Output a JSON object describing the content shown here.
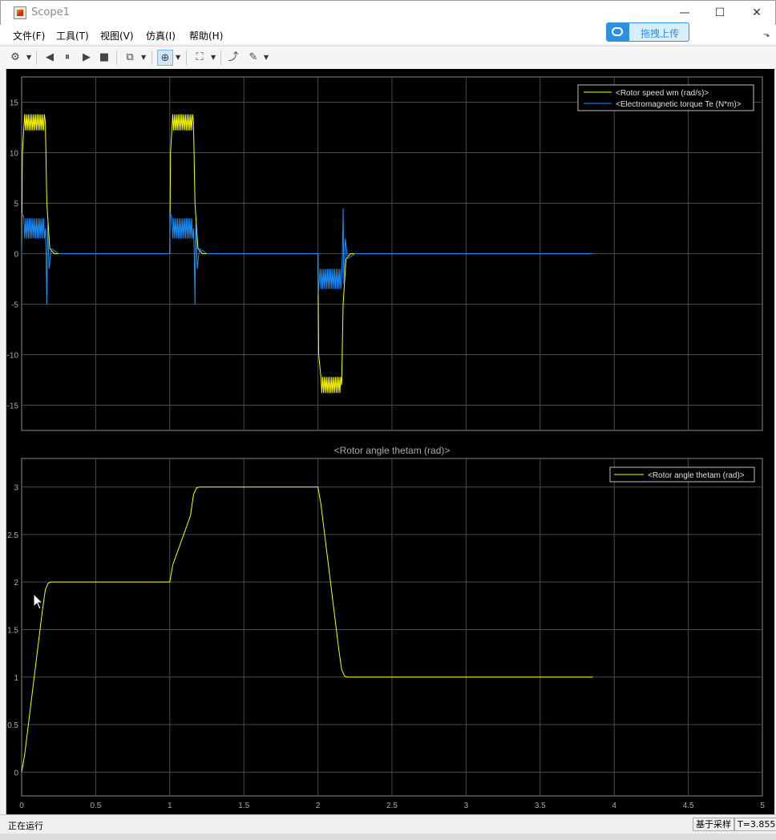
{
  "window": {
    "title": "Scope1",
    "minimize_glyph": "—",
    "maximize_glyph": "☐",
    "close_glyph": "✕"
  },
  "menu": {
    "items": [
      "文件(F)",
      "工具(T)",
      "视图(V)",
      "仿真(I)",
      "帮助(H)"
    ],
    "upload_button": "拖拽上传"
  },
  "toolbar": {
    "icons": [
      "gear-icon",
      "step-back-icon",
      "pause-icon",
      "step-forward-icon",
      "stop-icon",
      "signal-selector-icon",
      "zoom-in-icon",
      "autoscale-icon",
      "restore-icon",
      "style-icon"
    ]
  },
  "colors": {
    "plot_bg": "#000000",
    "axes_text": "#aaaaaa",
    "grid": "#4a4a4a",
    "speed": "#ffff00",
    "torque": "#1e90ff",
    "angle": "#ffff00"
  },
  "chart_data": [
    {
      "type": "line",
      "title": "",
      "xlabel": "",
      "ylabel": "",
      "xlim": [
        0,
        5
      ],
      "ylim": [
        -17.5,
        17.5
      ],
      "xticks": [
        "0",
        "0.5",
        "1",
        "1.5",
        "2",
        "2.5",
        "3",
        "3.5",
        "4",
        "4.5",
        "5"
      ],
      "yticks": [
        "-15",
        "-10",
        "-5",
        "0",
        "5",
        "10",
        "15"
      ],
      "grid": true,
      "legend_position": "top-right",
      "series": [
        {
          "name": "<Rotor speed wm (rad/s)>",
          "color": "#ffff00",
          "x": [
            0,
            0.005,
            0.02,
            0.16,
            0.17,
            0.19,
            0.22,
            1.0,
            1.005,
            1.02,
            1.16,
            1.17,
            1.19,
            1.22,
            2.0,
            2.005,
            2.02,
            2.16,
            2.17,
            2.19,
            2.22,
            3.855
          ],
          "values": [
            0,
            10,
            13,
            13,
            5,
            0.5,
            0,
            0,
            10,
            13,
            13,
            5,
            0.5,
            0,
            0,
            -10,
            -13,
            -13,
            -5,
            -0.5,
            0,
            0
          ],
          "ripple": {
            "amplitude": 0.8,
            "period": 0.012
          }
        },
        {
          "name": "<Electromagnetic torque Te (N*m)>",
          "color": "#1e90ff",
          "x": [
            0,
            0.003,
            0.015,
            0.16,
            0.165,
            0.17,
            0.175,
            0.185,
            0.2,
            0.25,
            1.0,
            1.003,
            1.015,
            1.16,
            1.165,
            1.17,
            1.175,
            1.185,
            1.2,
            1.25,
            2.0,
            2.003,
            2.015,
            2.16,
            2.165,
            2.17,
            2.175,
            2.185,
            2.2,
            2.25,
            3.855
          ],
          "values": [
            0,
            4,
            2.5,
            2.5,
            0,
            -5,
            3,
            -1.5,
            0.5,
            0,
            0,
            4,
            2.5,
            2.5,
            0,
            -5,
            3,
            -1.5,
            0.5,
            0,
            0,
            -4,
            -2.5,
            -2.5,
            0,
            4.5,
            -3,
            1.5,
            -0.5,
            0,
            0
          ],
          "ripple": {
            "amplitude": 1.0,
            "period": 0.012
          }
        }
      ]
    },
    {
      "type": "line",
      "title": "<Rotor angle thetam (rad)>",
      "xlabel": "",
      "ylabel": "",
      "xlim": [
        0,
        5
      ],
      "ylim": [
        -0.25,
        3.3
      ],
      "xticks": [
        "0",
        "0.5",
        "1",
        "1.5",
        "2",
        "2.5",
        "3",
        "3.5",
        "4",
        "4.5",
        "5"
      ],
      "yticks": [
        "0",
        "0.5",
        "1",
        "1.5",
        "2",
        "2.5",
        "3"
      ],
      "grid": true,
      "legend_position": "top-right",
      "series": [
        {
          "name": "<Rotor angle thetam (rad)>",
          "color": "#ffff00",
          "x": [
            0,
            0.02,
            0.14,
            0.16,
            0.18,
            0.2,
            1.0,
            1.02,
            1.14,
            1.16,
            1.18,
            1.2,
            2.0,
            2.02,
            2.14,
            2.16,
            2.18,
            2.2,
            3.855
          ],
          "values": [
            0,
            0.18,
            1.7,
            1.92,
            1.99,
            2.0,
            2.0,
            2.18,
            2.7,
            2.92,
            2.99,
            3.0,
            3.0,
            2.82,
            1.3,
            1.08,
            1.01,
            1.0,
            1.0
          ]
        }
      ]
    }
  ],
  "status": {
    "left": "正在运行",
    "mode": "基于采样",
    "time": "T=3.855"
  }
}
